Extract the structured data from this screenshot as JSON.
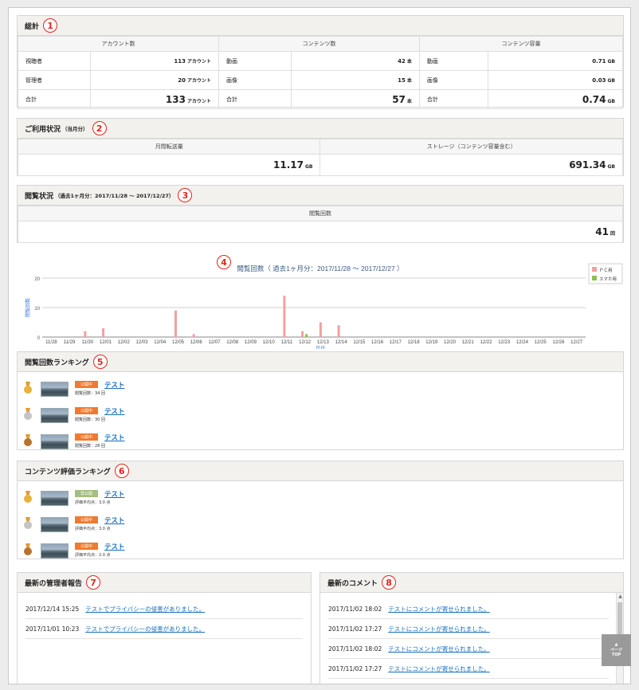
{
  "summary": {
    "title": "総計",
    "marker": "1",
    "headers": [
      "アカウント数",
      "コンテンツ数",
      "コンテンツ容量"
    ],
    "rows": [
      {
        "a_label": "視聴者",
        "a_value": "113",
        "a_unit": "アカウント",
        "b_label": "動画",
        "b_value": "42",
        "b_unit": "本",
        "c_label": "動画",
        "c_value": "0.71",
        "c_unit": "GB"
      },
      {
        "a_label": "管理者",
        "a_value": "20",
        "a_unit": "アカウント",
        "b_label": "画像",
        "b_value": "15",
        "b_unit": "本",
        "c_label": "画像",
        "c_value": "0.03",
        "c_unit": "GB"
      },
      {
        "a_label": "合計",
        "a_value": "133",
        "a_unit": "アカウント",
        "b_label": "合計",
        "b_value": "57",
        "b_unit": "本",
        "c_label": "合計",
        "c_value": "0.74",
        "c_unit": "GB"
      }
    ]
  },
  "usage": {
    "title": "ご利用状況",
    "subtitle": "（当月分）",
    "marker": "2",
    "headers": [
      "月間転送量",
      "ストレージ（コンテンツ容量含む）"
    ],
    "transfer_value": "11.17",
    "transfer_unit": "GB",
    "storage_value": "691.34",
    "storage_unit": "GB"
  },
  "views": {
    "title": "閲覧状況",
    "subtitle": "（過去1ヶ月分：2017/11/28 〜 2017/12/27）",
    "marker": "3",
    "header": "閲覧回数",
    "value": "41",
    "unit": "回"
  },
  "chart_marker": "4",
  "chart_data": {
    "type": "bar",
    "title": "閲覧回数（ 過去1ヶ月分：2017/11/28 〜 2017/12/27 ）",
    "xlabel": "日付",
    "ylabel": "閲覧回数",
    "ylim": [
      0,
      20
    ],
    "yticks": [
      "0",
      "10",
      "20"
    ],
    "grid": true,
    "legend_position": "top-right",
    "categories": [
      "11/28",
      "11/29",
      "11/30",
      "12/01",
      "12/02",
      "12/03",
      "12/04",
      "12/05",
      "12/06",
      "12/07",
      "12/08",
      "12/09",
      "12/10",
      "12/11",
      "12/12",
      "12/13",
      "12/14",
      "12/15",
      "12/16",
      "12/17",
      "12/18",
      "12/19",
      "12/20",
      "12/21",
      "12/22",
      "12/23",
      "12/24",
      "12/25",
      "12/26",
      "12/27"
    ],
    "series": [
      {
        "name": "ＰＣ用",
        "color": "#f4a0a0",
        "values": [
          0,
          0,
          2,
          3,
          0,
          0,
          0,
          9,
          1,
          0,
          0,
          0,
          0,
          14,
          2,
          5,
          4,
          0,
          0,
          0,
          0,
          0,
          0,
          0,
          0,
          0,
          0,
          0,
          0,
          0
        ]
      },
      {
        "name": "スマホ用",
        "color": "#8bc34a",
        "values": [
          0,
          0,
          0,
          0,
          0,
          0,
          0,
          0,
          0,
          0,
          0,
          0,
          0,
          0,
          1,
          0,
          0,
          0,
          0,
          0,
          0,
          0,
          0,
          0,
          0,
          0,
          0,
          0,
          0,
          0
        ]
      }
    ]
  },
  "view_ranking": {
    "title": "閲覧回数ランキング",
    "marker": "5",
    "items": [
      {
        "status": "公開中",
        "status_color": "#f07a2d",
        "name": "テスト",
        "stat": "閲覧回数：34 回",
        "medal": "gold"
      },
      {
        "status": "公開中",
        "status_color": "#f07a2d",
        "name": "テスト",
        "stat": "閲覧回数：30 回",
        "medal": "silver"
      },
      {
        "status": "公開中",
        "status_color": "#f07a2d",
        "name": "テスト",
        "stat": "閲覧回数：28 回",
        "medal": "bronze"
      }
    ]
  },
  "rating_ranking": {
    "title": "コンテンツ評価ランキング",
    "marker": "6",
    "items": [
      {
        "status": "非公開",
        "status_color": "#a5bf7f",
        "name": "テスト",
        "stat": "評価平均点：3.0 点",
        "medal": "gold"
      },
      {
        "status": "公開中",
        "status_color": "#f07a2d",
        "name": "テスト",
        "stat": "評価平均点：3.0 点",
        "medal": "silver"
      },
      {
        "status": "公開中",
        "status_color": "#f07a2d",
        "name": "テスト",
        "stat": "評価平均点：2.0 点",
        "medal": "bronze"
      }
    ]
  },
  "admin_reports": {
    "title": "最新の管理者報告",
    "marker": "7",
    "items": [
      {
        "date": "2017/12/14 15:25",
        "text": "テストでプライバシーの侵害がありました。"
      },
      {
        "date": "2017/11/01 10:23",
        "text": "テストでプライバシーの侵害がありました。"
      }
    ]
  },
  "comments": {
    "title": "最新のコメント",
    "marker": "8",
    "items": [
      {
        "date": "2017/11/02 18:02",
        "text": "テストにコメントが寄せられました。"
      },
      {
        "date": "2017/11/02 17:27",
        "text": "テストにコメントが寄せられました。"
      },
      {
        "date": "2017/11/02 18:02",
        "text": "テストにコメントが寄せられました。"
      },
      {
        "date": "2017/11/02 17:27",
        "text": "テストにコメントが寄せられました。"
      }
    ]
  },
  "page_top": {
    "line1": "ページ",
    "line2": "TOP",
    "arrow": "▲"
  },
  "colors": {
    "accent_red": "#e2261c",
    "link": "#1a6fbf",
    "gold": "#e8b23a",
    "silver": "#c4c4c4",
    "bronze": "#b8742f"
  }
}
